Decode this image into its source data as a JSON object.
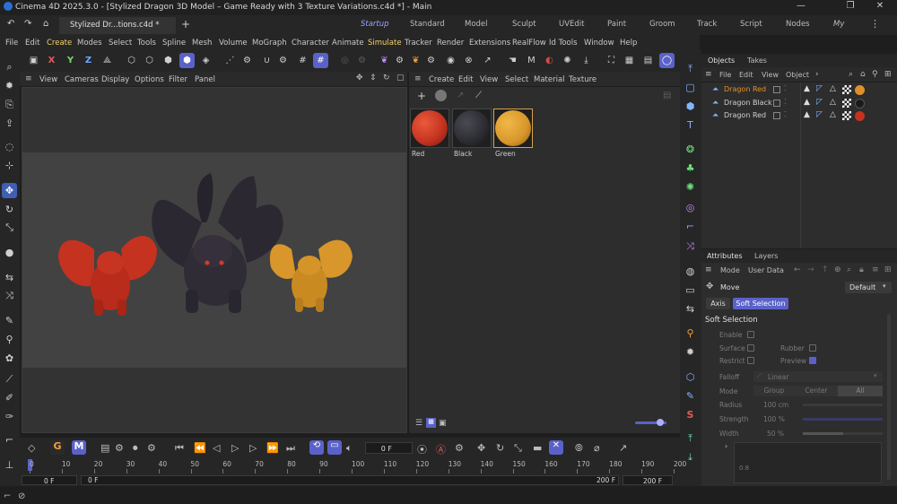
{
  "window": {
    "title": "Cinema 4D 2025.3.0 - [Stylized Dragon 3D Model – Game Ready with 3 Texture Variations.c4d *] - Main",
    "controls": [
      "—",
      "❐",
      "✕"
    ]
  },
  "doc_tab": "Stylized Dr...tions.c4d *",
  "add_tab": "+",
  "layouts": [
    "Startup",
    "Standard",
    "Model",
    "Sculpt",
    "UVEdit",
    "Paint",
    "Groom",
    "Track",
    "Script",
    "Nodes",
    "My"
  ],
  "active_layout": "Startup",
  "menu": [
    "File",
    "Edit",
    "Create",
    "Modes",
    "Select",
    "Tools",
    "Spline",
    "Mesh",
    "Volume",
    "MoGraph",
    "Character",
    "Animate",
    "Simulate",
    "Tracker",
    "Render",
    "Extensions",
    "RealFlow",
    "Id Tools",
    "Window",
    "Help"
  ],
  "main_toolbar": {
    "axis_x": "X",
    "axis_y": "Y",
    "axis_z": "Z"
  },
  "viewport": {
    "menu": [
      "View",
      "Cameras",
      "Display",
      "Options",
      "Filter",
      "Panel"
    ]
  },
  "materials": {
    "menu": [
      "Create",
      "Edit",
      "View",
      "Select",
      "Material",
      "Texture"
    ],
    "items": [
      {
        "name": "Red",
        "color": "#c2311f"
      },
      {
        "name": "Black",
        "color": "#2a2a30"
      },
      {
        "name": "Green",
        "color": "#d7962a"
      }
    ]
  },
  "objects_panel": {
    "tabs": [
      "Objects",
      "Takes"
    ],
    "menu": [
      "File",
      "Edit",
      "View",
      "Object"
    ],
    "items": [
      {
        "name": "Dragon Red",
        "color": "#e0902a"
      },
      {
        "name": "Dragon Black",
        "color": "#cfcfcf"
      },
      {
        "name": "Dragon Red",
        "color": "#cfcfcf"
      }
    ]
  },
  "attributes": {
    "tabs": [
      "Attributes",
      "Layers"
    ],
    "menu": [
      "Mode",
      "User Data"
    ],
    "tool_name": "Move",
    "preset": "Default",
    "subtabs": [
      "Axis",
      "Soft Selection"
    ],
    "section": "Soft Selection",
    "enable": "Enable",
    "surface": "Surface",
    "rubber": "Rubber",
    "restrict": "Restrict",
    "preview": "Preview",
    "falloff_label": "Falloff",
    "falloff_value": "Linear",
    "mode_label": "Mode",
    "mode_options": [
      "Group",
      "Center",
      "All"
    ],
    "radius_label": "Radius",
    "radius_value": "100 cm",
    "strength_label": "Strength",
    "strength_value": "100 %",
    "width_label": "Width",
    "width_value": "50 %",
    "curve_value": "0.8"
  },
  "timeline": {
    "current_frame": "0 F",
    "ticks": [
      "0",
      "10",
      "20",
      "30",
      "40",
      "50",
      "60",
      "70",
      "80",
      "90",
      "100",
      "110",
      "120",
      "130",
      "140",
      "150",
      "160",
      "170",
      "180",
      "190",
      "200"
    ],
    "range_start": "0 F",
    "range_start2": "0 F",
    "range_end": "200 F",
    "range_end2": "200 F"
  },
  "colors": {
    "accent": "#5a62c9",
    "highlight_menu": "#f3d26b",
    "dragon_red": "#c5321f",
    "dragon_black": "#2c2832",
    "dragon_gold": "#d9962a"
  }
}
